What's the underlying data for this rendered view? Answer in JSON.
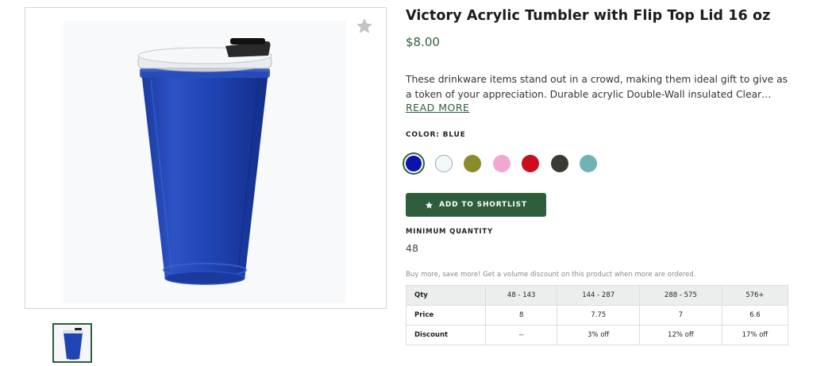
{
  "product": {
    "title": "Victory Acrylic Tumbler with Flip Top Lid 16 oz",
    "price": "$8.00",
    "description": "These drinkware items stand out in a crowd, making them ideal gift to give as a token of your appreciation. Durable acrylic Double-Wall insulated Clear Acrylic Lid with Flip-Top Closure.",
    "read_more": "READ MORE"
  },
  "color": {
    "label": "COLOR: BLUE",
    "swatches": [
      {
        "name": "Blue",
        "hex": "#0a14a8",
        "selected": true
      },
      {
        "name": "Clear",
        "hex": "#f3f8fb",
        "selected": false
      },
      {
        "name": "Olive",
        "hex": "#8c8b2a",
        "selected": false
      },
      {
        "name": "Pink",
        "hex": "#f1a8d0",
        "selected": false
      },
      {
        "name": "Red",
        "hex": "#cc0d1d",
        "selected": false
      },
      {
        "name": "Black",
        "hex": "#3a3a30",
        "selected": false
      },
      {
        "name": "Teal",
        "hex": "#6fb3b5",
        "selected": false
      }
    ]
  },
  "actions": {
    "shortlist_label": "ADD TO SHORTLIST",
    "favorite_icon": "star-icon"
  },
  "minimum_quantity": {
    "label": "MINIMUM QUANTITY",
    "value": "48"
  },
  "pricing": {
    "note": "Buy more, save more! Get a volume discount on this product when more are ordered.",
    "rows": [
      {
        "label": "Qty",
        "cells": [
          "48 - 143",
          "144 - 287",
          "288 - 575",
          "576+"
        ]
      },
      {
        "label": "Price",
        "cells": [
          "8",
          "7.75",
          "7",
          "6.6"
        ]
      },
      {
        "label": "Discount",
        "cells": [
          "--",
          "3% off",
          "12% off",
          "17% off"
        ]
      }
    ]
  },
  "colors": {
    "accent": "#2e5e3b",
    "product_blue": "#1f3fa8"
  }
}
